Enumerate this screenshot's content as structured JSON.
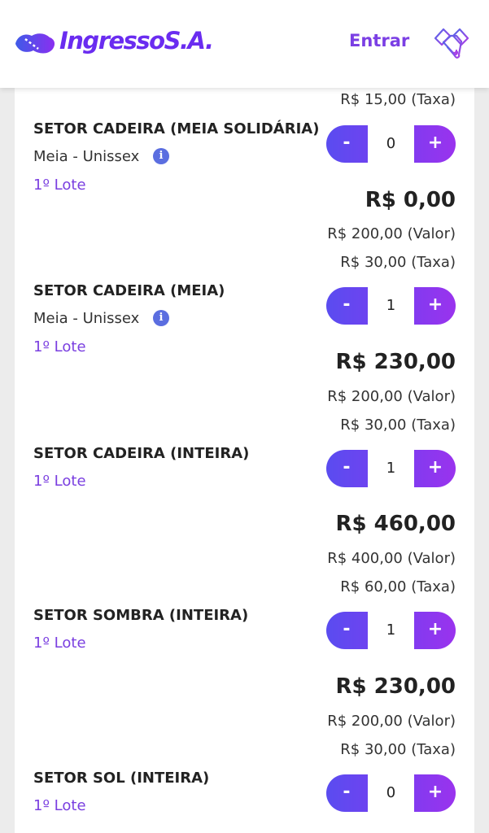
{
  "header": {
    "brand": "IngressoS.A.",
    "login_label": "Entrar",
    "logo_icon": "ticket-logo-icon",
    "partner_icon": "handshake-icon",
    "brand_color": "#6a2cf0"
  },
  "top_fee": "R$ 15,00 (Taxa)",
  "stepper_labels": {
    "minus": "-",
    "plus": "+"
  },
  "sectors": [
    {
      "name": "SETOR CADEIRA (MEIA SOLIDÁRIA)",
      "subtitle": "Meia - Unissex",
      "lot": "1º Lote",
      "quantity": "0",
      "total": "R$ 0,00",
      "value": "R$ 200,00 (Valor)",
      "fee": "R$ 30,00 (Taxa)"
    },
    {
      "name": "SETOR CADEIRA (MEIA)",
      "subtitle": "Meia - Unissex",
      "lot": "1º Lote",
      "quantity": "1",
      "total": "R$ 230,00",
      "value": "R$ 200,00 (Valor)",
      "fee": "R$ 30,00 (Taxa)"
    },
    {
      "name": "SETOR CADEIRA (INTEIRA)",
      "lot": "1º Lote",
      "quantity": "1",
      "total": "R$ 460,00",
      "value": "R$ 400,00 (Valor)",
      "fee": "R$ 60,00 (Taxa)"
    },
    {
      "name": "SETOR SOMBRA (INTEIRA)",
      "lot": "1º Lote",
      "quantity": "1",
      "total": "R$ 230,00",
      "value": "R$ 200,00 (Valor)",
      "fee": "R$ 30,00 (Taxa)"
    },
    {
      "name": "SETOR SOL (INTEIRA)",
      "lot": "1º Lote",
      "quantity": "0"
    }
  ]
}
